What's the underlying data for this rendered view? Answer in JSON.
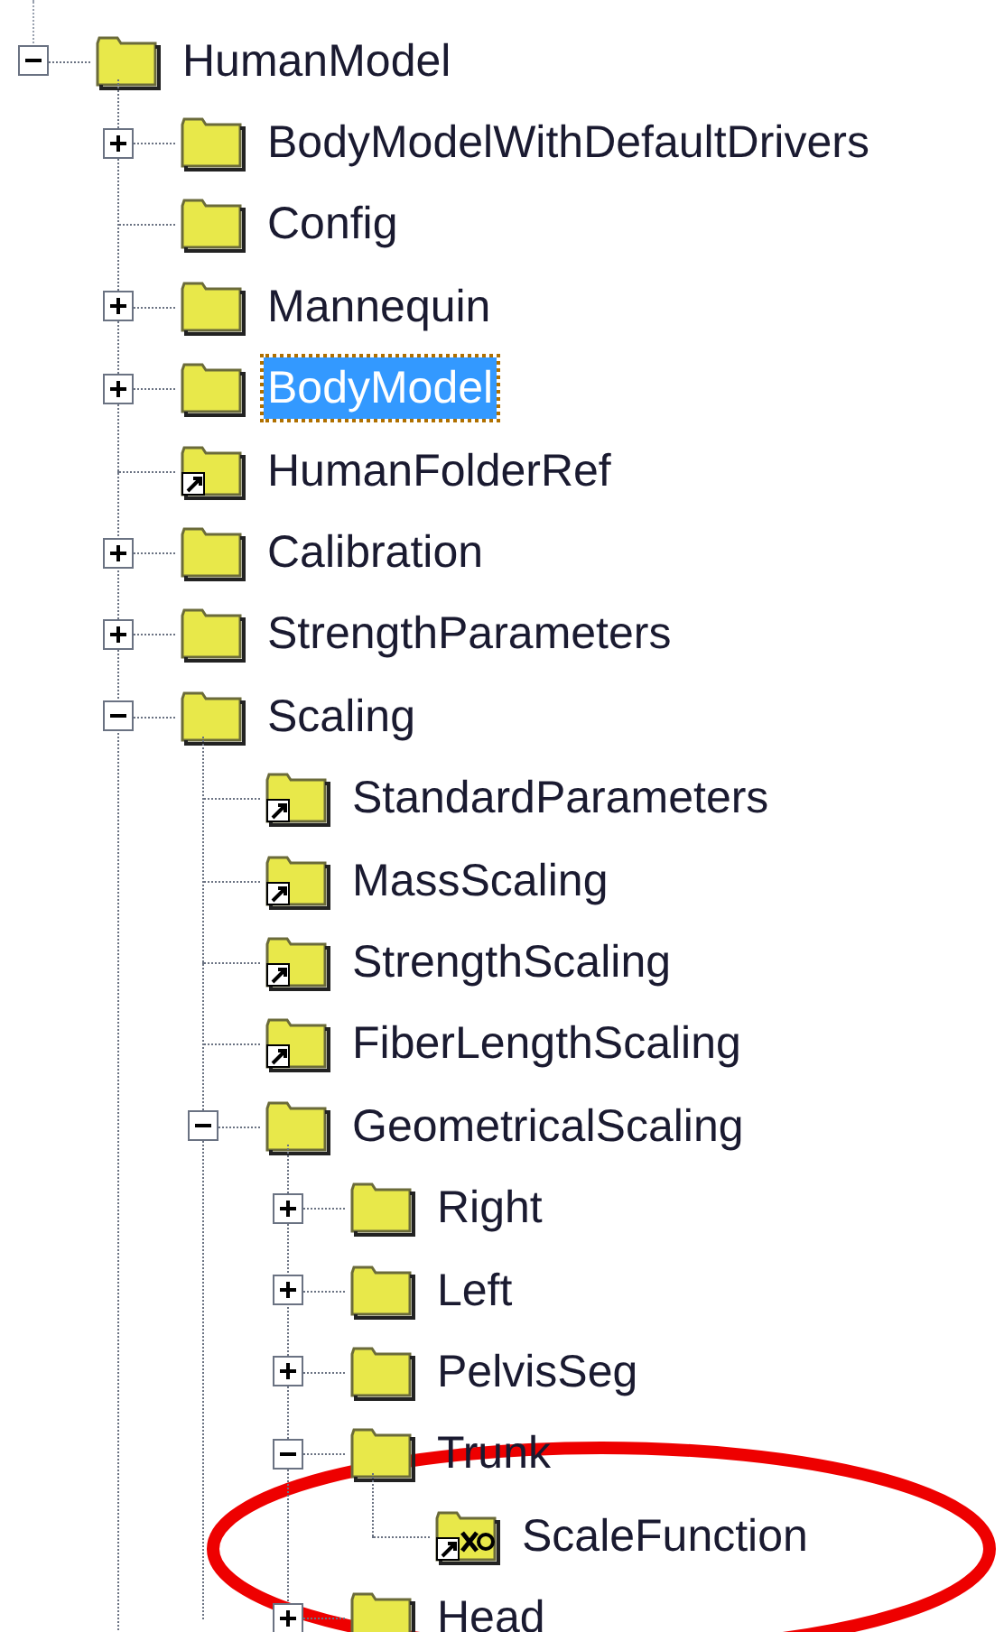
{
  "tree": [
    {
      "label": "HumanModel",
      "kind": "folder",
      "expanded": true,
      "selected": false,
      "children": [
        {
          "label": "BodyModelWithDefaultDrivers",
          "kind": "folder",
          "expanded": false,
          "selected": false
        },
        {
          "label": "Config",
          "kind": "folder",
          "selected": false
        },
        {
          "label": "Mannequin",
          "kind": "folder",
          "expanded": false,
          "selected": false
        },
        {
          "label": "BodyModel",
          "kind": "folder",
          "expanded": false,
          "selected": true
        },
        {
          "label": "HumanFolderRef",
          "kind": "folder-link",
          "selected": false
        },
        {
          "label": "Calibration",
          "kind": "folder",
          "expanded": false,
          "selected": false
        },
        {
          "label": "StrengthParameters",
          "kind": "folder",
          "expanded": false,
          "selected": false
        },
        {
          "label": "Scaling",
          "kind": "folder",
          "expanded": true,
          "selected": false,
          "children": [
            {
              "label": "StandardParameters",
              "kind": "folder-link",
              "selected": false
            },
            {
              "label": "MassScaling",
              "kind": "folder-link",
              "selected": false
            },
            {
              "label": "StrengthScaling",
              "kind": "folder-link",
              "selected": false
            },
            {
              "label": "FiberLengthScaling",
              "kind": "folder-link",
              "selected": false
            },
            {
              "label": "GeometricalScaling",
              "kind": "folder",
              "expanded": true,
              "selected": false,
              "children": [
                {
                  "label": "Right",
                  "kind": "folder",
                  "expanded": false,
                  "selected": false
                },
                {
                  "label": "Left",
                  "kind": "folder",
                  "expanded": false,
                  "selected": false
                },
                {
                  "label": "PelvisSeg",
                  "kind": "folder",
                  "expanded": false,
                  "selected": false
                },
                {
                  "label": "Trunk",
                  "kind": "folder",
                  "expanded": true,
                  "selected": false,
                  "children": [
                    {
                      "label": "ScaleFunction",
                      "kind": "function-link",
                      "selected": false
                    }
                  ]
                },
                {
                  "label": "Head",
                  "kind": "folder",
                  "expanded": false,
                  "selected": false
                }
              ]
            }
          ]
        }
      ]
    }
  ],
  "highlight": {
    "kind": "ellipse"
  }
}
